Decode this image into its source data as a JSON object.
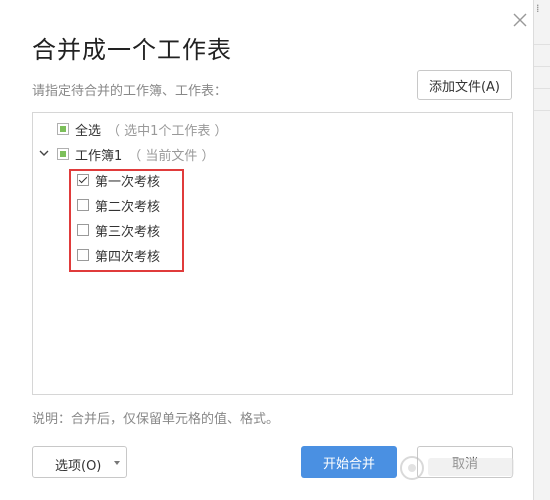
{
  "dialog": {
    "title": "合并成一个工作表",
    "instruction": "请指定待合并的工作簿、工作表：",
    "add_file_label": "添加文件(A)"
  },
  "tree": {
    "select_all": {
      "label": "全选",
      "hint": "（ 选中1个工作表 ）",
      "state": "partial"
    },
    "workbook": {
      "label": "工作簿1",
      "hint": "（ 当前文件 ）",
      "expanded": true,
      "state": "partial"
    },
    "sheets": [
      {
        "label": "第一次考核",
        "checked": true
      },
      {
        "label": "第二次考核",
        "checked": false
      },
      {
        "label": "第三次考核",
        "checked": false
      },
      {
        "label": "第四次考核",
        "checked": false
      }
    ]
  },
  "explanation": "说明：合并后，仅保留单元格的值、格式。",
  "footer": {
    "options_label": "选项(O)",
    "start_label": "开始合并",
    "cancel_label": "取消"
  },
  "colors": {
    "accent": "#4a90e2",
    "partial_check": "#7cbf5a",
    "highlight": "#e03b3b"
  },
  "icons": {
    "close": "close-icon",
    "expand": "chevron-down-icon",
    "dropdown": "caret-down-icon"
  }
}
